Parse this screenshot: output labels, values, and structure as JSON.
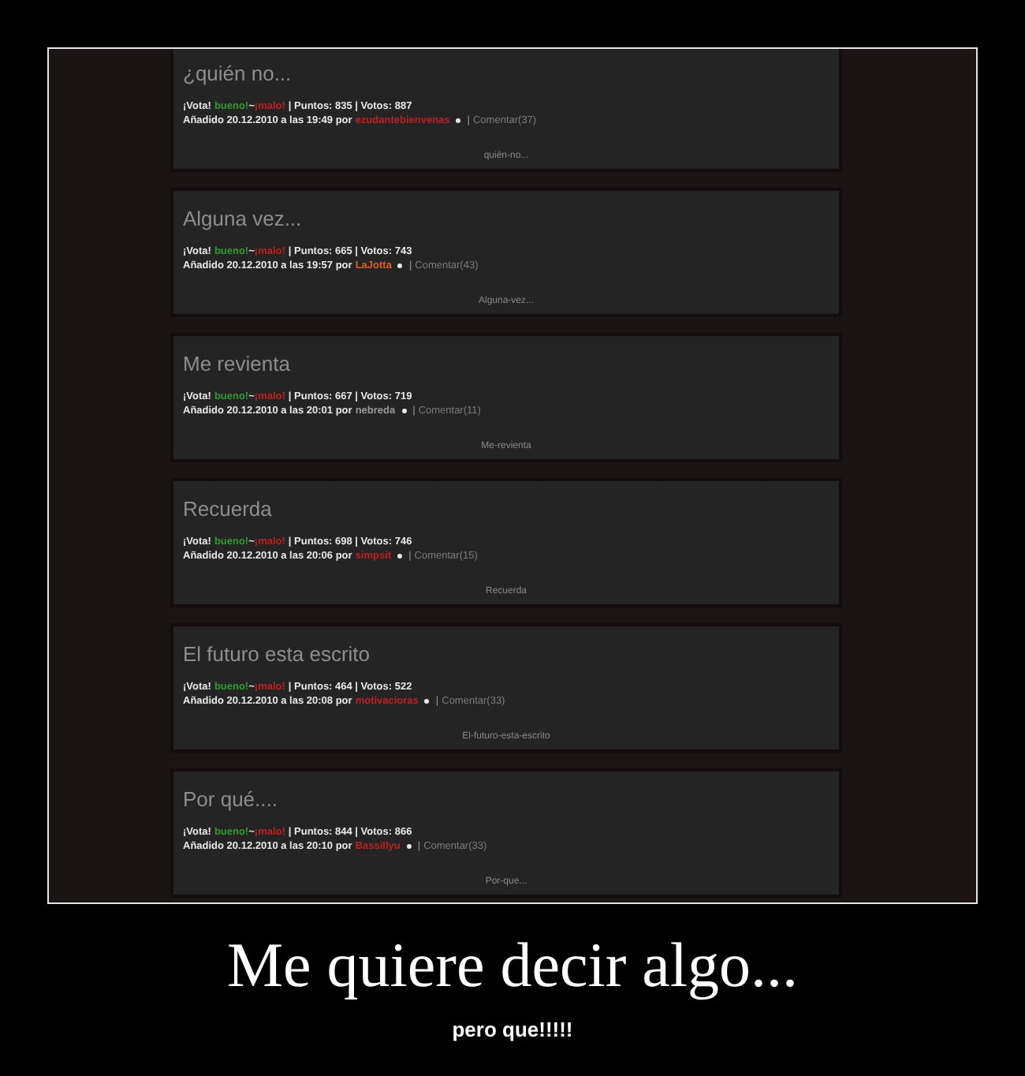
{
  "posts": [
    {
      "title": "¿quién no...",
      "vote_label": "¡Vota!",
      "good": "bueno!",
      "between": "~",
      "bad": "¡malo!",
      "stats": "| Puntos: 835 | Votos: 887",
      "added": "Añadido 20.12.2010 a las 19:49 por",
      "author": {
        "name": "ezudantebienvenas",
        "color": "#c0201e"
      },
      "divider": "|",
      "comments": "Comentar(37)",
      "slug": "quién-no..."
    },
    {
      "title": "Alguna vez...",
      "vote_label": "¡Vota!",
      "good": "bueno!",
      "between": "~",
      "bad": "¡malo!",
      "stats": "| Puntos: 665 | Votos: 743",
      "added": "Añadido 20.12.2010 a las 19:57 por",
      "author": {
        "name": "LaJotta",
        "color": "#e0601a"
      },
      "divider": "|",
      "comments": "Comentar(43)",
      "slug": "Alguna-vez..."
    },
    {
      "title": "Me revienta",
      "vote_label": "¡Vota!",
      "good": "bueno!",
      "between": "~",
      "bad": "¡malo!",
      "stats": "| Puntos: 667 | Votos: 719",
      "added": "Añadido 20.12.2010 a las 20:01 por",
      "author": {
        "name": "nebreda",
        "color": "#9a9a9a"
      },
      "divider": "|",
      "comments": "Comentar(11)",
      "slug": "Me-revienta"
    },
    {
      "title": "Recuerda",
      "vote_label": "¡Vota!",
      "good": "bueno!",
      "between": "~",
      "bad": "¡malo!",
      "stats": "| Puntos: 698 | Votos: 746",
      "added": "Añadido 20.12.2010 a las 20:06 por",
      "author": {
        "name": "simpsit",
        "color": "#c0201e"
      },
      "divider": "|",
      "comments": "Comentar(15)",
      "slug": "Recuerda"
    },
    {
      "title": "El futuro esta escrito",
      "vote_label": "¡Vota!",
      "good": "bueno!",
      "between": "~",
      "bad": "¡malo!",
      "stats": "| Puntos: 464 | Votos: 522",
      "added": "Añadido 20.12.2010 a las 20:08 por",
      "author": {
        "name": "motivacioras",
        "color": "#c0201e"
      },
      "divider": "|",
      "comments": "Comentar(33)",
      "slug": "El-futuro-esta-escrito"
    },
    {
      "title": "Por qué....",
      "vote_label": "¡Vota!",
      "good": "bueno!",
      "between": "~",
      "bad": "¡malo!",
      "stats": "| Puntos: 844 | Votos: 866",
      "added": "Añadido 20.12.2010 a las 20:10 por",
      "author": {
        "name": "Bassillyu",
        "color": "#c0201e"
      },
      "divider": "|",
      "comments": "Comentar(33)",
      "slug": "Por-que..."
    }
  ],
  "caption": {
    "title": "Me quiere decir algo...",
    "subtitle": "pero que!!!!!"
  }
}
